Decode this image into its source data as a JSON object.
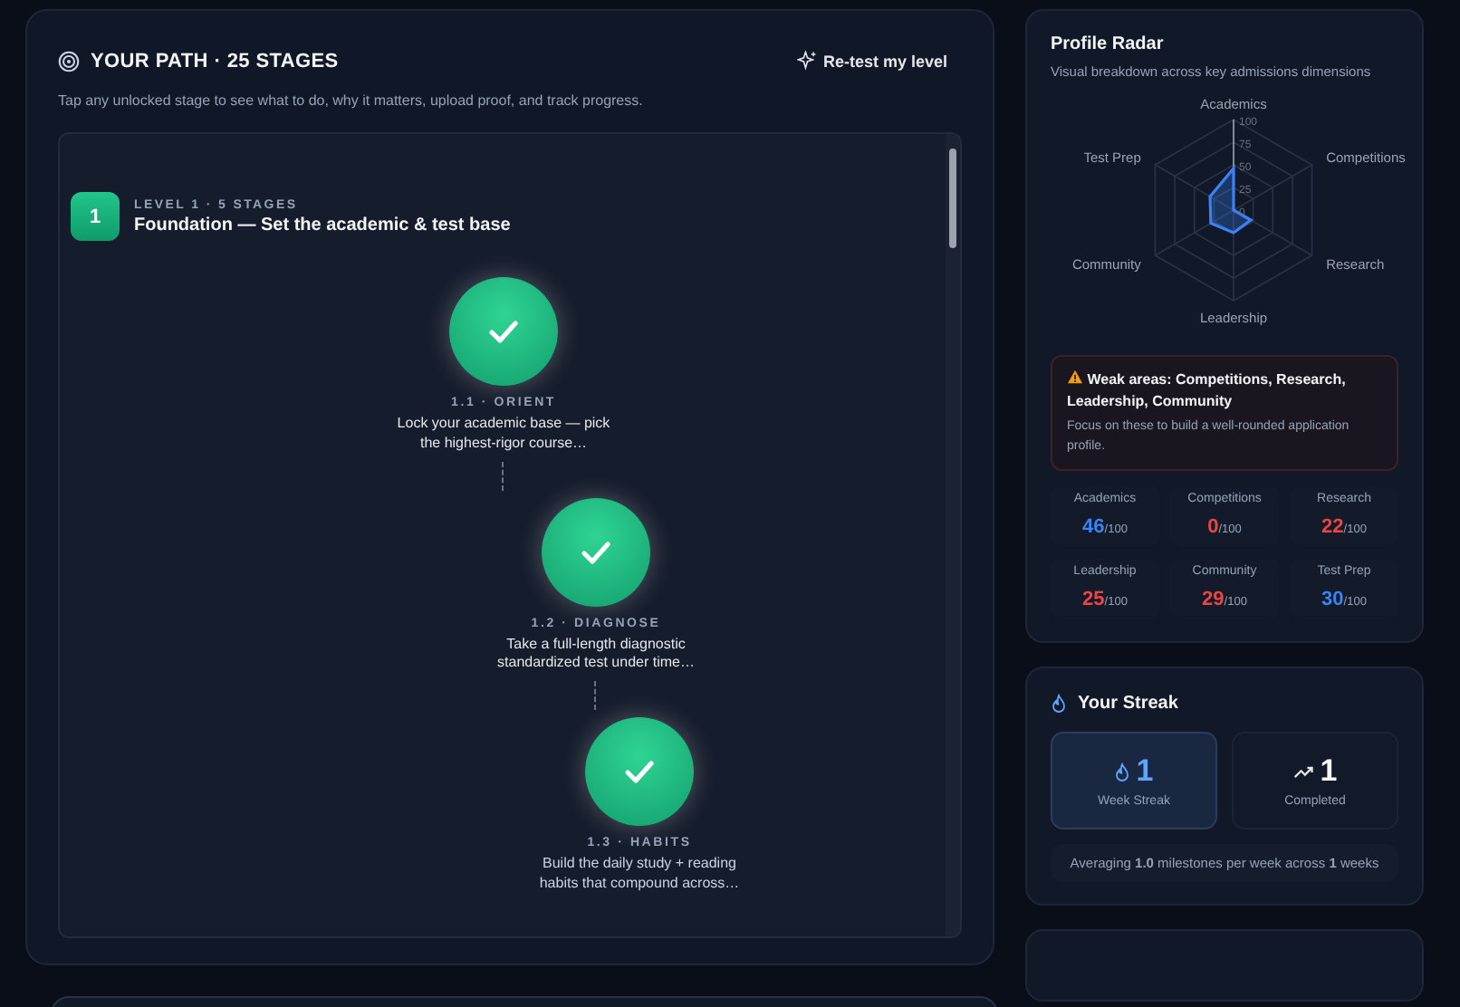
{
  "path": {
    "title": "YOUR PATH · 25 STAGES",
    "retest_button": "Re-test my level",
    "subtitle": "Tap any unlocked stage to see what to do, why it matters, upload proof, and track progress.",
    "level": {
      "number": "1",
      "eyebrow": "LEVEL 1 · 5 STAGES",
      "title": "Foundation — Set the academic & test base"
    },
    "stages": [
      {
        "code": "1.1 · ORIENT",
        "description": "Lock your academic base — pick the highest-rigor course…",
        "completed": true
      },
      {
        "code": "1.2 · DIAGNOSE",
        "description": "Take a full-length diagnostic standardized test under time…",
        "completed": true
      },
      {
        "code": "1.3 · HABITS",
        "description": "Build the daily study + reading habits that compound across…",
        "completed": true
      }
    ]
  },
  "radar": {
    "title": "Profile Radar",
    "subtitle": "Visual breakdown across key admissions dimensions",
    "axes": [
      "Academics",
      "Competitions",
      "Research",
      "Leadership",
      "Community",
      "Test Prep"
    ],
    "ticks": [
      "100",
      "75",
      "50",
      "25",
      "0"
    ],
    "warning": {
      "title": "Weak areas: Competitions, Research, Leadership, Community",
      "body": "Focus on these to build a well-rounded application profile."
    },
    "scores": [
      {
        "label": "Academics",
        "value": "46",
        "max": "/100",
        "weak": false
      },
      {
        "label": "Competitions",
        "value": "0",
        "max": "/100",
        "weak": true
      },
      {
        "label": "Research",
        "value": "22",
        "max": "/100",
        "weak": true
      },
      {
        "label": "Leadership",
        "value": "25",
        "max": "/100",
        "weak": true
      },
      {
        "label": "Community",
        "value": "29",
        "max": "/100",
        "weak": true
      },
      {
        "label": "Test Prep",
        "value": "30",
        "max": "/100",
        "weak": false
      }
    ]
  },
  "streak": {
    "title": "Your Streak",
    "stats": [
      {
        "kind": "streak",
        "value": "1",
        "label": "Week Streak",
        "selected": true
      },
      {
        "kind": "completed",
        "value": "1",
        "label": "Completed",
        "selected": false
      }
    ],
    "summary": "Averaging **1.0** milestones per week across **1** weeks"
  }
}
